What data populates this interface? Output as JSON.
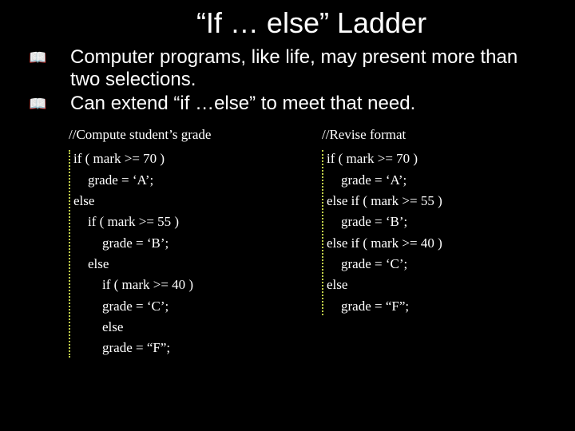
{
  "title": "“If … else” Ladder",
  "bullets": [
    "Computer programs, like life, may present more than two selections.",
    "Can extend “if …else” to meet that need."
  ],
  "col_left": {
    "heading": "//Compute student’s grade",
    "lines": [
      {
        "text": "if ( mark >= 70 )",
        "indent": 0
      },
      {
        "text": "grade = ‘A’;",
        "indent": 1
      },
      {
        "text": "else",
        "indent": 0
      },
      {
        "text": "if ( mark >= 55 )",
        "indent": 1
      },
      {
        "text": "grade = ‘B’;",
        "indent": 2
      },
      {
        "text": "else",
        "indent": 1
      },
      {
        "text": "if ( mark >= 40 )",
        "indent": 2
      },
      {
        "text": "grade = ‘C’;",
        "indent": 2
      },
      {
        "text": "else",
        "indent": 2
      },
      {
        "text": "grade = “F”;",
        "indent": 2
      }
    ]
  },
  "col_right": {
    "heading": "//Revise format",
    "lines": [
      {
        "text": "if ( mark >= 70 )",
        "indent": 0
      },
      {
        "text": "grade = ‘A’;",
        "indent": 1
      },
      {
        "text": "else if ( mark >= 55 )",
        "indent": 0
      },
      {
        "text": "grade = ‘B’;",
        "indent": 1
      },
      {
        "text": "else if ( mark >= 40 )",
        "indent": 0
      },
      {
        "text": "grade = ‘C’;",
        "indent": 1
      },
      {
        "text": "else",
        "indent": 0
      },
      {
        "text": "grade = “F”;",
        "indent": 1
      }
    ]
  }
}
